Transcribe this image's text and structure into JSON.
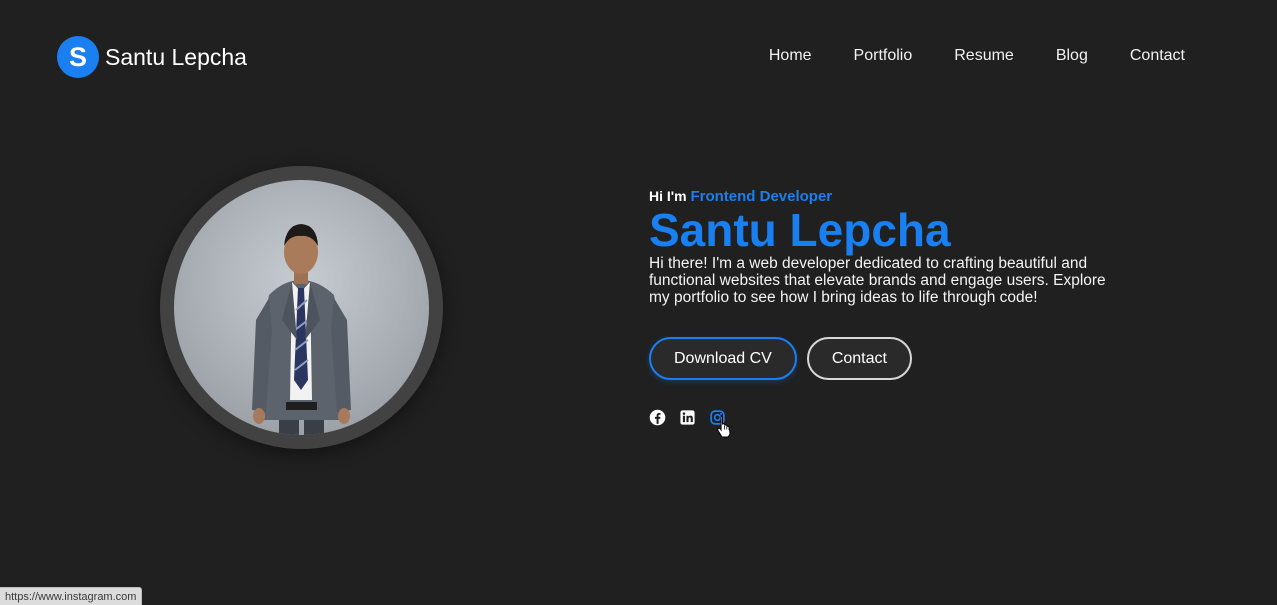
{
  "brand": {
    "logo_letter": "S",
    "name": "Santu Lepcha"
  },
  "nav": {
    "items": [
      {
        "label": "Home"
      },
      {
        "label": "Portfolio"
      },
      {
        "label": "Resume"
      },
      {
        "label": "Blog"
      },
      {
        "label": "Contact"
      }
    ]
  },
  "hero": {
    "greeting": "Hi I'm",
    "role": "Frontend Developer",
    "name": "Santu Lepcha",
    "description": "Hi there! I'm a web developer dedicated to crafting beautiful and functional websites that elevate brands and engage users. Explore my portfolio to see how I bring ideas to life through code!",
    "buttons": {
      "download_cv": "Download CV",
      "contact": "Contact"
    },
    "socials": [
      {
        "icon": "facebook-icon"
      },
      {
        "icon": "linkedin-icon"
      },
      {
        "icon": "instagram-icon"
      }
    ]
  },
  "status_bar": {
    "url": "https://www.instagram.com"
  },
  "colors": {
    "background": "#202020",
    "accent": "#1a7ff0",
    "text": "#ffffff",
    "ring": "#424242"
  }
}
